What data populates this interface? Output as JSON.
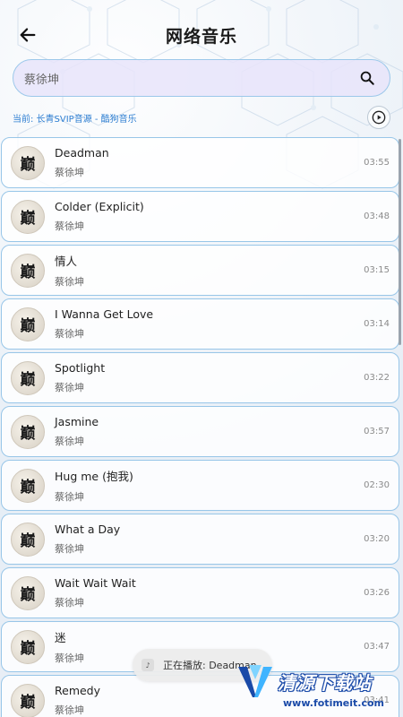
{
  "header": {
    "title": "网络音乐"
  },
  "search": {
    "value": "蔡徐坤",
    "placeholder": ""
  },
  "source": {
    "label": "当前: 长青SVIP音源 - 酷狗音乐"
  },
  "cover_glyph": "巅",
  "songs": [
    {
      "title": "Deadman",
      "artist": "蔡徐坤",
      "duration": "03:55"
    },
    {
      "title": "Colder (Explicit)",
      "artist": "蔡徐坤",
      "duration": "03:48"
    },
    {
      "title": "情人",
      "artist": "蔡徐坤",
      "duration": "03:15"
    },
    {
      "title": "I Wanna Get Love",
      "artist": "蔡徐坤",
      "duration": "03:14"
    },
    {
      "title": "Spotlight",
      "artist": "蔡徐坤",
      "duration": "03:22"
    },
    {
      "title": "Jasmine",
      "artist": "蔡徐坤",
      "duration": "03:57"
    },
    {
      "title": "Hug me (抱我)",
      "artist": "蔡徐坤",
      "duration": "02:30"
    },
    {
      "title": "What a Day",
      "artist": "蔡徐坤",
      "duration": "03:20"
    },
    {
      "title": "Wait Wait Wait",
      "artist": "蔡徐坤",
      "duration": "03:26"
    },
    {
      "title": "迷",
      "artist": "蔡徐坤",
      "duration": "03:47"
    },
    {
      "title": "Remedy",
      "artist": "蔡徐坤",
      "duration": "03:41"
    }
  ],
  "toast": {
    "text": "正在播放: Deadman"
  },
  "watermark": {
    "name": "清源下载站",
    "url": "www.fotimeit.com"
  },
  "colors": {
    "accent": "#2f7fd2",
    "row_border": "#98c6e8",
    "search_bg": "#e8e4fa"
  },
  "icons": {
    "back": "arrow-left-icon",
    "search": "search-icon",
    "play": "play-circle-icon"
  }
}
